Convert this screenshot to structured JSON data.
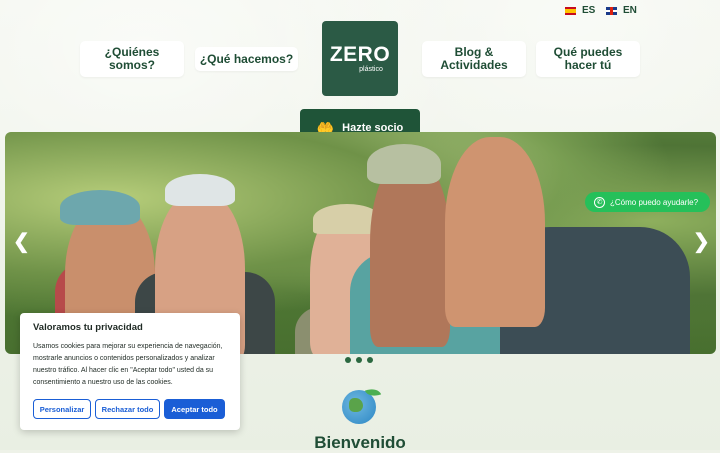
{
  "languages": {
    "es": {
      "code": "ES",
      "flag": "flag-spain-icon"
    },
    "en": {
      "code": "EN",
      "flag": "flag-uk-icon"
    }
  },
  "nav": {
    "quienes": "¿Quiénes somos?",
    "que_hacemos": "¿Qué hacemos?",
    "blog": "Blog & Actividades",
    "que_puedes": "Qué puedes hacer tú"
  },
  "logo": {
    "main": "ZERO",
    "sub": "plástico"
  },
  "cta": {
    "label": "Hazte socio",
    "icon": "hand-heart-icon"
  },
  "hero": {
    "arrow_left": "❮",
    "arrow_right": "❯",
    "slide_count": 3
  },
  "whatsapp": {
    "label": "¿Cómo puedo ayudarle?"
  },
  "cookie": {
    "title": "Valoramos tu privacidad",
    "text": "Usamos cookies para mejorar su experiencia de navegación, mostrarle anuncios o contenidos personalizados y analizar nuestro tráfico. Al hacer clic en \"Aceptar todo\" usted da su consentimiento a nuestro uso de las cookies.",
    "customize": "Personalizar",
    "reject": "Rechazar todo",
    "accept": "Aceptar todo"
  },
  "welcome": {
    "title": "Bienvenido"
  },
  "colors": {
    "brand": "#1f5438",
    "accent": "#1a5ed6",
    "whatsapp": "#25c05a"
  }
}
